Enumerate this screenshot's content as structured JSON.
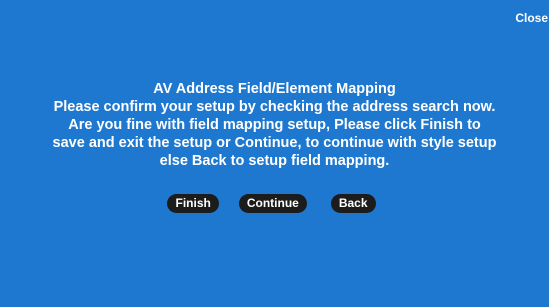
{
  "dialog": {
    "close_label": "Close",
    "title": "AV Address Field/Element Mapping",
    "message_lines": [
      "Please confirm your setup by checking the address search now.",
      "Are you fine with field mapping setup, Please click Finish to",
      "save and exit the setup or Continue, to continue with style setup",
      "else Back to setup field mapping."
    ],
    "buttons": {
      "finish": "Finish",
      "continue": "Continue",
      "back": "Back"
    },
    "colors": {
      "background": "#1f78cf",
      "button": "#1c1c1c",
      "text": "#ffffff"
    }
  }
}
